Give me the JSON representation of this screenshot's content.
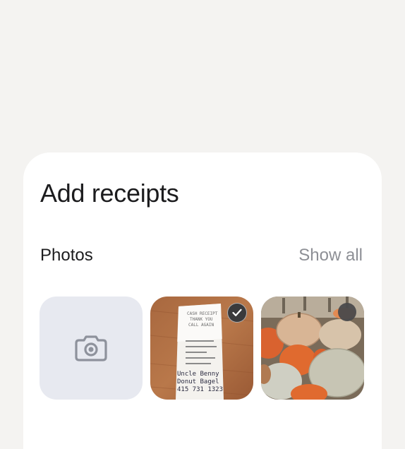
{
  "sheet": {
    "title": "Add receipts",
    "photos_section": {
      "label": "Photos",
      "show_all_label": "Show all"
    },
    "tiles": [
      {
        "kind": "camera",
        "icon": "camera-icon"
      },
      {
        "kind": "photo",
        "subject": "receipt",
        "selected": true,
        "badge_icon": "checkmark-icon",
        "receipt_text": {
          "header_line1": "CASH RECEIPT",
          "header_line2": "THANK YOU",
          "header_line3": "CALL AGAIN",
          "handwritten_line1": "Uncle Benny",
          "handwritten_line2": "Donut Bagel",
          "handwritten_line3": "415 731 1323"
        }
      },
      {
        "kind": "photo",
        "subject": "pumpkins",
        "selected": false
      }
    ]
  },
  "colors": {
    "page_background": "#f4f3f1",
    "sheet_background": "#ffffff",
    "camera_tile_background": "#e7e9f0",
    "camera_icon": "#8e929c",
    "title_text": "#1c1c1e",
    "show_all_text": "#8d8f95"
  }
}
